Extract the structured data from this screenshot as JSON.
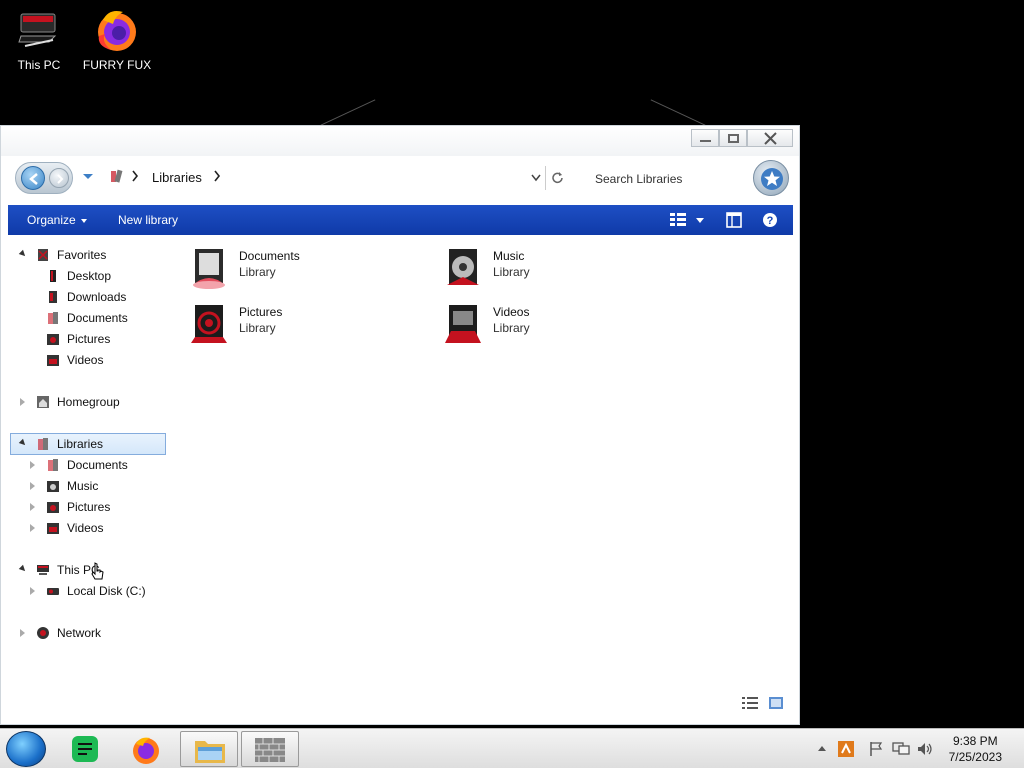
{
  "desktop": {
    "icons": [
      {
        "label": "This PC",
        "icon": "computer-icon"
      },
      {
        "label": "FURRY FUX",
        "icon": "firefox-icon"
      }
    ]
  },
  "window": {
    "breadcrumb": {
      "root_icon": "libraries-icon",
      "current": "Libraries"
    },
    "search_placeholder": "Search Libraries",
    "toolbar": {
      "organize": "Organize",
      "new_library": "New library"
    },
    "nav": {
      "favorites": {
        "label": "Favorites",
        "items": [
          "Desktop",
          "Downloads",
          "Documents",
          "Pictures",
          "Videos"
        ]
      },
      "homegroup": "Homegroup",
      "libraries": {
        "label": "Libraries",
        "items": [
          "Documents",
          "Music",
          "Pictures",
          "Videos"
        ]
      },
      "this_pc": {
        "label": "This PC",
        "items": [
          "Local Disk (C:)"
        ]
      },
      "network": "Network"
    },
    "libraries": [
      {
        "name": "Documents",
        "type": "Library",
        "icon": "documents-library-icon"
      },
      {
        "name": "Music",
        "type": "Library",
        "icon": "music-library-icon"
      },
      {
        "name": "Pictures",
        "type": "Library",
        "icon": "pictures-library-icon"
      },
      {
        "name": "Videos",
        "type": "Library",
        "icon": "videos-library-icon"
      }
    ]
  },
  "taskbar": {
    "apps": [
      "start-orb",
      "notes-app",
      "firefox",
      "file-explorer",
      "sandbox-app"
    ],
    "clock": {
      "time": "9:38 PM",
      "date": "7/25/2023"
    }
  },
  "colors": {
    "toolbar_blue": "#1546b8",
    "accent_red": "#c4121f"
  }
}
